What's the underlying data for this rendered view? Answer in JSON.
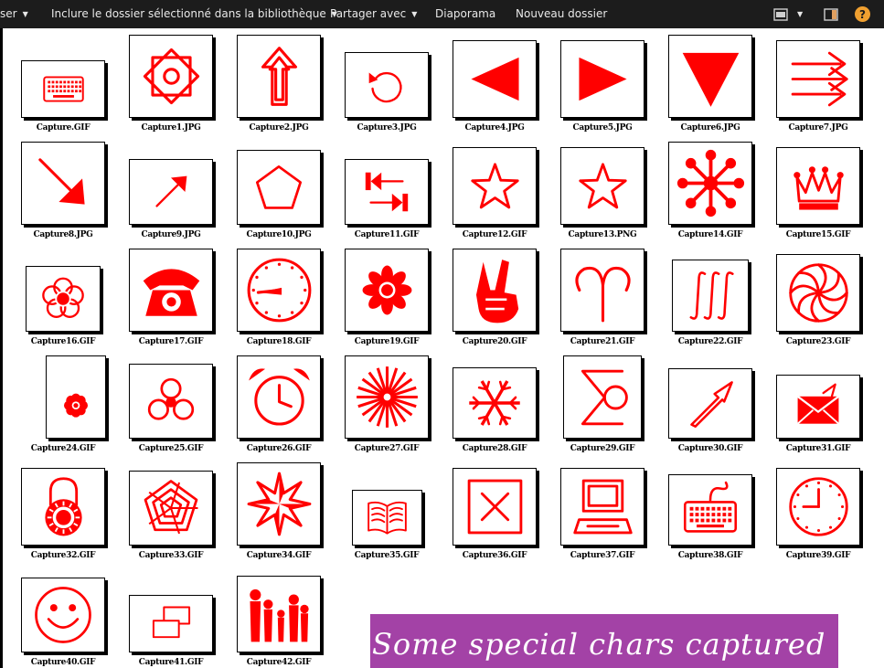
{
  "toolbar": {
    "organize_label": "ser",
    "include_label": "Inclure le dossier sélectionné dans la bibliothèque",
    "share_label": "Partager avec",
    "slideshow_label": "Diaporama",
    "newfolder_label": "Nouveau dossier",
    "help_label": "?"
  },
  "colors": {
    "icon_red": "#ff0000",
    "banner_bg": "#a342a6",
    "toolbar_bg": "#1c1c1c",
    "help_badge": "#f0a030"
  },
  "files": [
    {
      "name": "Capture.GIF",
      "icon": "keyboard-icon"
    },
    {
      "name": "Capture1.JPG",
      "icon": "star-of-squares-icon"
    },
    {
      "name": "Capture2.JPG",
      "icon": "up-arrow-outline-icon"
    },
    {
      "name": "Capture3.JPG",
      "icon": "rotate-icon"
    },
    {
      "name": "Capture4.JPG",
      "icon": "triangle-left-icon"
    },
    {
      "name": "Capture5.JPG",
      "icon": "triangle-right-icon"
    },
    {
      "name": "Capture6.JPG",
      "icon": "triangle-down-icon"
    },
    {
      "name": "Capture7.JPG",
      "icon": "triple-arrow-right-icon"
    },
    {
      "name": "Capture8.JPG",
      "icon": "arrow-down-right-icon"
    },
    {
      "name": "Capture9.JPG",
      "icon": "arrow-up-right-icon"
    },
    {
      "name": "Capture10.JPG",
      "icon": "pentagon-icon"
    },
    {
      "name": "Capture11.GIF",
      "icon": "swap-arrows-icon"
    },
    {
      "name": "Capture12.GIF",
      "icon": "star-outline-icon"
    },
    {
      "name": "Capture13.PNG",
      "icon": "star-outline-icon"
    },
    {
      "name": "Capture14.GIF",
      "icon": "asterisk-dots-icon"
    },
    {
      "name": "Capture15.GIF",
      "icon": "crown-icon"
    },
    {
      "name": "Capture16.GIF",
      "icon": "flower-icon"
    },
    {
      "name": "Capture17.GIF",
      "icon": "telephone-icon"
    },
    {
      "name": "Capture18.GIF",
      "icon": "clock-face-icon"
    },
    {
      "name": "Capture19.GIF",
      "icon": "florette-icon"
    },
    {
      "name": "Capture20.GIF",
      "icon": "victory-hand-icon"
    },
    {
      "name": "Capture21.GIF",
      "icon": "aries-icon"
    },
    {
      "name": "Capture22.GIF",
      "icon": "triple-integral-icon"
    },
    {
      "name": "Capture23.GIF",
      "icon": "pinwheel-icon"
    },
    {
      "name": "Capture24.GIF",
      "icon": "small-flower-icon"
    },
    {
      "name": "Capture25.GIF",
      "icon": "trefoil-icon"
    },
    {
      "name": "Capture26.GIF",
      "icon": "alarm-clock-icon"
    },
    {
      "name": "Capture27.GIF",
      "icon": "starburst-icon"
    },
    {
      "name": "Capture28.GIF",
      "icon": "snowflake-icon"
    },
    {
      "name": "Capture29.GIF",
      "icon": "sigma-icon"
    },
    {
      "name": "Capture30.GIF",
      "icon": "outline-arrow-icon"
    },
    {
      "name": "Capture31.GIF",
      "icon": "envelope-icon"
    },
    {
      "name": "Capture32.GIF",
      "icon": "padlock-icon"
    },
    {
      "name": "Capture33.GIF",
      "icon": "spider-web-icon"
    },
    {
      "name": "Capture34.GIF",
      "icon": "eight-point-star-icon"
    },
    {
      "name": "Capture35.GIF",
      "icon": "open-book-icon"
    },
    {
      "name": "Capture36.GIF",
      "icon": "ballot-x-icon"
    },
    {
      "name": "Capture37.GIF",
      "icon": "computer-icon"
    },
    {
      "name": "Capture38.GIF",
      "icon": "keyboard-cable-icon"
    },
    {
      "name": "Capture39.GIF",
      "icon": "wall-clock-icon"
    },
    {
      "name": "Capture40.GIF",
      "icon": "smiley-icon"
    },
    {
      "name": "Capture41.GIF",
      "icon": "windows-icon"
    },
    {
      "name": "Capture42.GIF",
      "icon": "family-icon"
    }
  ],
  "banner": {
    "text": "Some special chars captured"
  }
}
